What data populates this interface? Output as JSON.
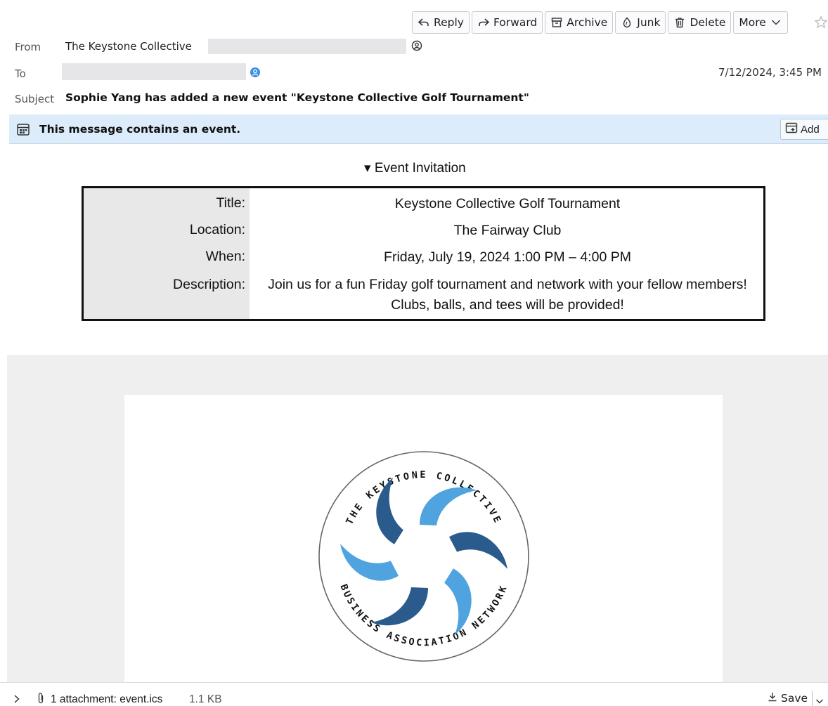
{
  "toolbar": {
    "reply": "Reply",
    "forward": "Forward",
    "archive": "Archive",
    "junk": "Junk",
    "delete": "Delete",
    "more": "More"
  },
  "header": {
    "from_label": "From",
    "from_name": "The Keystone Collective",
    "to_label": "To",
    "date": "7/12/2024, 3:45 PM",
    "subject_label": "Subject",
    "subject": "Sophie Yang has added a new event \"Keystone Collective Golf Tournament\""
  },
  "notice": {
    "text": "This message contains an event.",
    "add_label": "Add"
  },
  "invitation": {
    "heading": "▾ Event Invitation",
    "rows": [
      {
        "label": "Title:",
        "value": "Keystone Collective Golf Tournament"
      },
      {
        "label": "Location:",
        "value": "The Fairway Club"
      },
      {
        "label": "When:",
        "value": "Friday, July 19, 2024 1:00 PM – 4:00 PM"
      },
      {
        "label": "Description:",
        "value": "Join us for a fun Friday golf tournament and network with your fellow members! Clubs, balls, and tees will be provided!"
      }
    ]
  },
  "logo": {
    "top_text": "THE KEYSTONE COLLECTIVE",
    "bottom_text": "BUSINESS ASSOCIATION NETWORK",
    "colors": {
      "dark": "#2a5b8c",
      "light": "#4fa3df"
    }
  },
  "footer": {
    "attachment_text": "1 attachment: event.ics",
    "attachment_size": "1.1 KB",
    "save_label": "Save"
  }
}
